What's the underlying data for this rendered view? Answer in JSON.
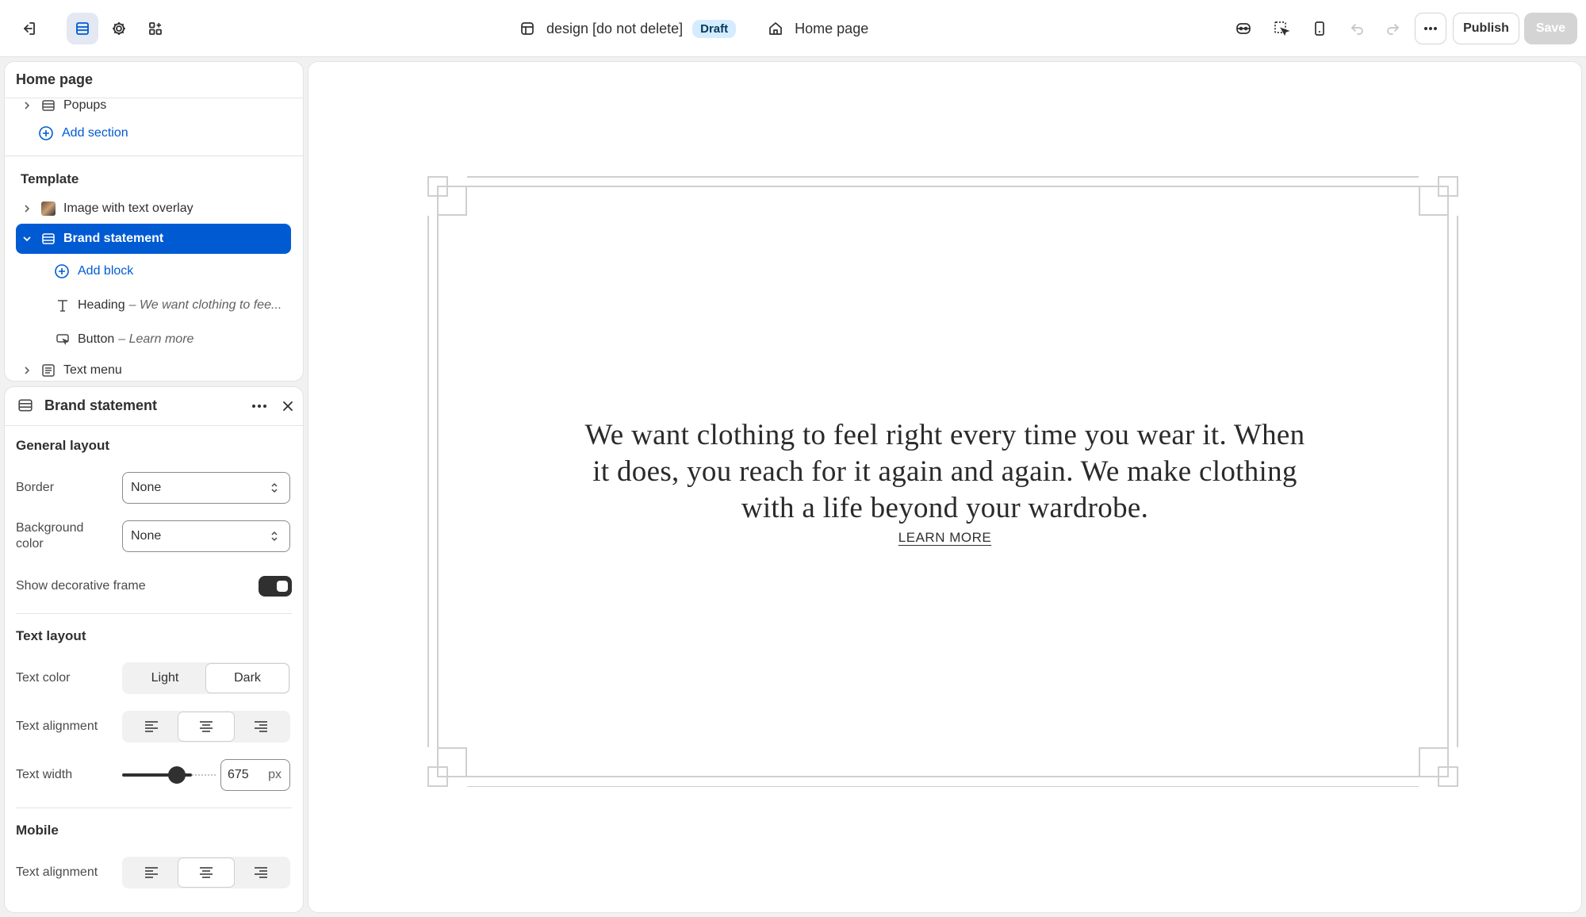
{
  "topbar": {
    "theme_name": "design [do not delete]",
    "status_badge": "Draft",
    "current_page": "Home page",
    "publish_label": "Publish",
    "save_label": "Save"
  },
  "tree": {
    "title": "Home page",
    "popups_label": "Popups",
    "add_section_label": "Add section",
    "template_heading": "Template",
    "items": [
      {
        "label": "Image with text overlay",
        "icon": "image-thumbnail"
      },
      {
        "label": "Brand statement",
        "icon": "section-icon",
        "selected": true
      }
    ],
    "add_block_label": "Add block",
    "blocks": [
      {
        "type": "Heading",
        "value": "– We want clothing to fee..."
      },
      {
        "type": "Button",
        "value": "– Learn more"
      }
    ],
    "text_menu_label": "Text menu"
  },
  "settings": {
    "title": "Brand statement",
    "general_layout": "General layout",
    "border_label": "Border",
    "border_value": "None",
    "bg_label_1": "Background",
    "bg_label_2": "color",
    "bg_value": "None",
    "frame_label": "Show decorative frame",
    "frame_on": true,
    "text_layout": "Text layout",
    "text_color_label": "Text color",
    "text_color_options": [
      "Light",
      "Dark"
    ],
    "text_color_selected": "Dark",
    "text_alignment_label": "Text alignment",
    "text_alignment_selected": "center",
    "text_width_label": "Text width",
    "text_width_value": "675",
    "text_width_unit": "px",
    "mobile_heading": "Mobile",
    "mobile_alignment_label": "Text alignment",
    "mobile_alignment_selected": "center"
  },
  "preview": {
    "statement": "We want clothing to feel right every time you wear it. When it does, you reach for it again and again. We make clothing with a life beyond your wardrobe.",
    "button_label": "LEARN MORE"
  },
  "colors": {
    "accent": "#005bd3",
    "badge_bg": "#d5ebff",
    "save_disabled": "#d4d4d4"
  }
}
